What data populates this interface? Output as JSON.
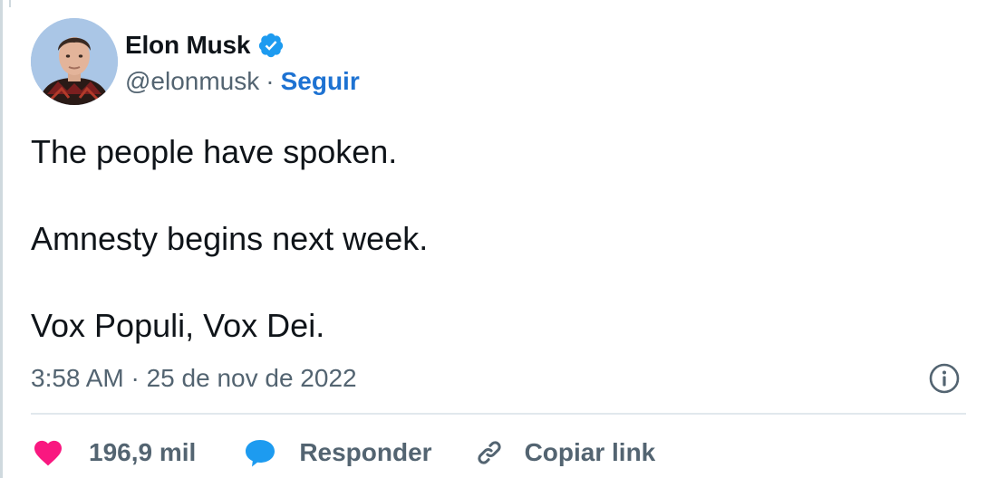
{
  "author": {
    "display_name": "Elon Musk",
    "handle": "@elonmusk",
    "separator": "·",
    "follow_label": "Seguir",
    "verified": true
  },
  "tweet": {
    "lines": [
      "The people have spoken.",
      "Amnesty begins next week.",
      "Vox Populi, Vox Dei."
    ],
    "timestamp": "3:58 AM · 25 de nov de 2022"
  },
  "actions": {
    "like_count": "196,9 mil",
    "reply_label": "Responder",
    "copy_link_label": "Copiar link"
  },
  "icons": {
    "verified": "verified-badge-icon",
    "info": "info-icon",
    "like": "heart-icon",
    "reply": "speech-bubble-icon",
    "copy_link": "link-icon"
  },
  "colors": {
    "accent": "#1d9bf0",
    "link": "#1d72d2",
    "like": "#f91880",
    "text_primary": "#0f1419",
    "text_secondary": "#536471"
  }
}
